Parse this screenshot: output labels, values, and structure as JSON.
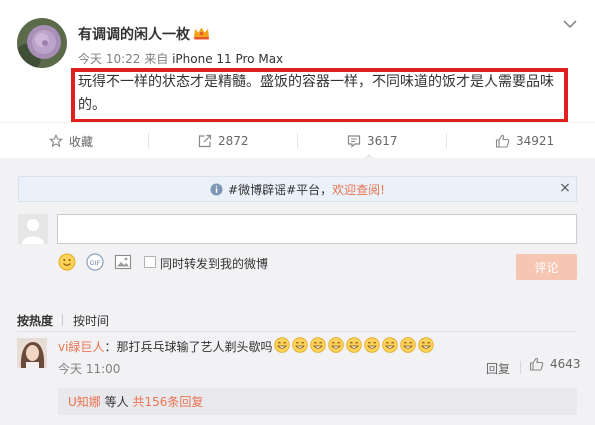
{
  "post": {
    "username": "有调调的闲人一枚",
    "timestamp": "今天 10:22",
    "source_prefix": "来自",
    "source_device": "iPhone 11 Pro Max",
    "content": "玩得不一样的状态才是精髓。盛饭的容器一样，不同味道的饭才是人需要品味的。",
    "icons": {
      "badge": "vip-crown-icon",
      "menu": "chevron-down-icon"
    },
    "highlight_color": "#e01f1f"
  },
  "actions": {
    "favorite_label": "收藏",
    "forward_count": "2872",
    "comment_count": "3617",
    "like_count": "34921"
  },
  "notice": {
    "tag": "#微博辟谣#平台，",
    "link": "欢迎查阅!",
    "close": "×"
  },
  "composer": {
    "input_value": "",
    "forward_label": "同时转发到我的微博",
    "submit_label": "评论",
    "tools": [
      "smile-emoji-icon",
      "gif-icon",
      "image-icon"
    ]
  },
  "sort": {
    "hot_label": "按热度",
    "time_label": "按时间"
  },
  "comment": {
    "user": "vi緑巨人",
    "text": "：那打兵乓球输了艺人剃头歇吗",
    "emoji_count": 9,
    "time": "今天 11:00",
    "reply_label": "回复",
    "like_count": "4643",
    "sub": {
      "user": "U知娜",
      "middle": " 等人 ",
      "count": "共156条回复"
    }
  },
  "colors": {
    "accent": "#eb7350",
    "submit_bg": "#f7c6b3",
    "comment_bg": "#f2f2f5"
  }
}
